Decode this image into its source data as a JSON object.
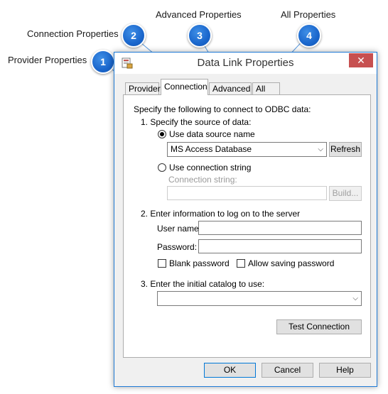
{
  "callouts": [
    {
      "number": "1",
      "label": "Provider Properties"
    },
    {
      "number": "2",
      "label": "Connection Properties"
    },
    {
      "number": "3",
      "label": "Advanced Properties"
    },
    {
      "number": "4",
      "label": "All Properties"
    }
  ],
  "window": {
    "title": "Data Link Properties",
    "close_glyph": "✕"
  },
  "tabs": [
    "Provider",
    "Connection",
    "Advanced",
    "All"
  ],
  "active_tab": "Connection",
  "connection": {
    "intro": "Specify the following to connect to ODBC data:",
    "step1": "1. Specify the source of data:",
    "use_dsn_label": "Use data source name",
    "dsn_value": "MS Access Database",
    "refresh_label": "Refresh",
    "use_conn_string_label": "Use connection string",
    "conn_string_label": "Connection string:",
    "build_label": "Build...",
    "step2": "2. Enter information to log on to the server",
    "user_name_label": "User name:",
    "password_label": "Password:",
    "blank_password_label": "Blank password",
    "allow_saving_label": "Allow saving password",
    "step3": "3. Enter the initial catalog to use:",
    "test_connection_label": "Test Connection"
  },
  "footer": {
    "ok": "OK",
    "cancel": "Cancel",
    "help": "Help"
  },
  "colors": {
    "badge": "#1a66cc",
    "close": "#c75050",
    "window_border": "#1e7ad6"
  }
}
